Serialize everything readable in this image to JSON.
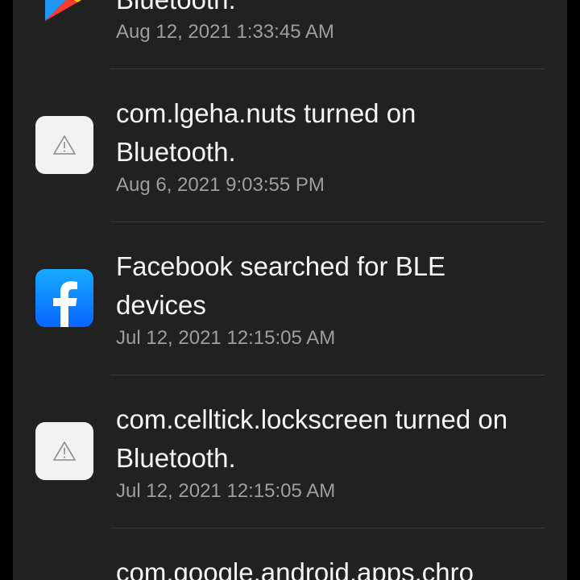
{
  "activity_log": {
    "entries": [
      {
        "icon": "google-play-icon",
        "title": "Bluetooth.",
        "timestamp": "Aug 12, 2021 1:33:45 AM"
      },
      {
        "icon": "warning-placeholder-icon",
        "title": "com.lgeha.nuts turned on Bluetooth.",
        "timestamp": "Aug 6, 2021 9:03:55 PM"
      },
      {
        "icon": "facebook-icon",
        "title": "Facebook searched for BLE devices",
        "timestamp": "Jul 12, 2021 12:15:05 AM"
      },
      {
        "icon": "warning-placeholder-icon",
        "title": "com.celltick.lockscreen turned on Bluetooth.",
        "timestamp": "Jul 12, 2021 12:15:05 AM"
      },
      {
        "icon": "",
        "title": "com.google.android.apps.chro",
        "timestamp": ""
      }
    ]
  },
  "colors": {
    "background": "#000000",
    "card": "#212121",
    "title_text": "#f5f5f5",
    "timestamp_text": "#9e9e9e",
    "divider": "#3a3a3a",
    "facebook_blue": "#0866ff"
  }
}
